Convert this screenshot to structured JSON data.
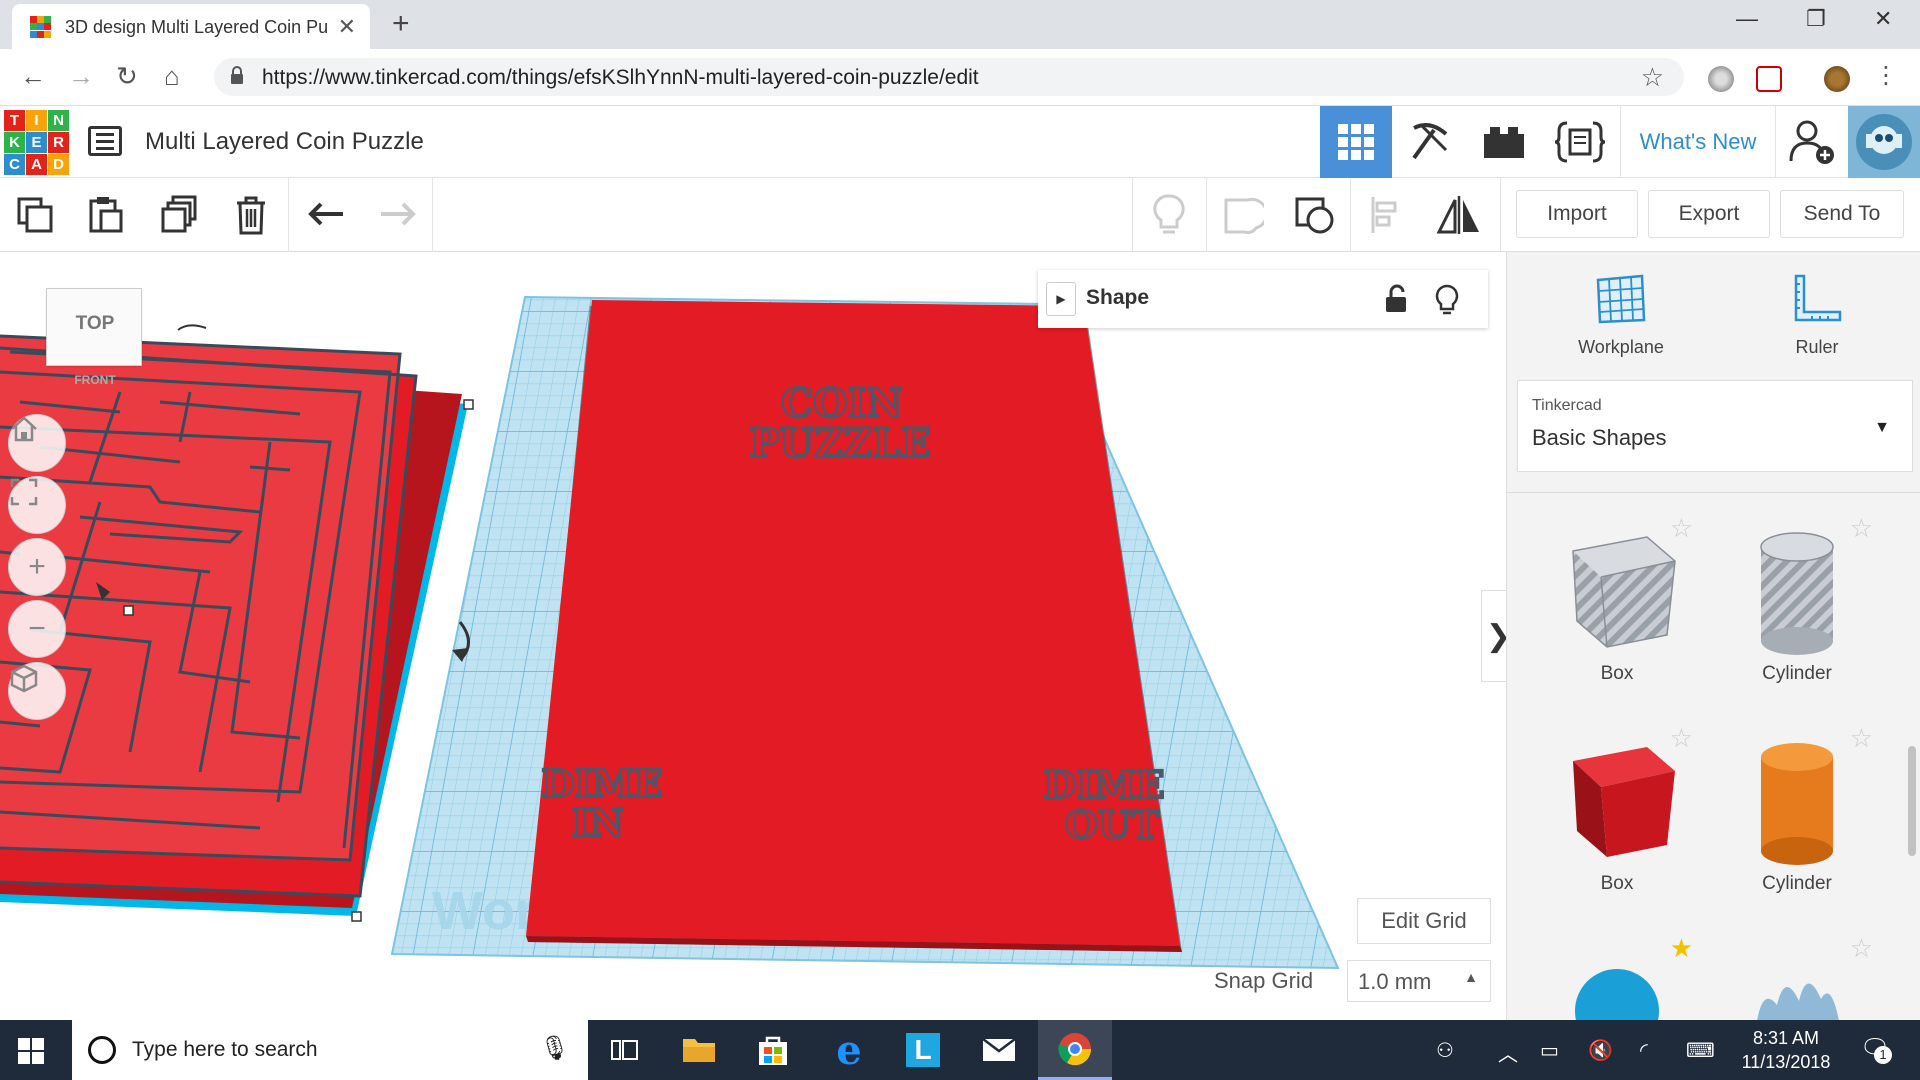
{
  "browser": {
    "tab_title": "3D design Multi Layered Coin Pu",
    "url": "https://www.tinkercad.com/things/efsKSlhYnnN-multi-layered-coin-puzzle/edit",
    "new_tab_symbol": "+",
    "close_symbol": "✕",
    "window_minimize": "—",
    "window_restore": "❐",
    "window_close": "✕"
  },
  "tinkercad": {
    "logo_letters": [
      "T",
      "I",
      "N",
      "K",
      "E",
      "R",
      "C",
      "A",
      "D"
    ],
    "logo_colors": [
      "#e2231a",
      "#f7a30c",
      "#2db34a",
      "#2db34a",
      "#2d8ecd",
      "#e2231a",
      "#2d8ecd",
      "#e2231a",
      "#f7a30c"
    ],
    "design_title": "Multi Layered Coin Puzzle",
    "whats_new": "What's New",
    "accent": "#4a90d9"
  },
  "toolbar": {
    "import_label": "Import",
    "export_label": "Export",
    "send_to_label": "Send To"
  },
  "viewport": {
    "viewcube_top": "TOP",
    "viewcube_front": "FRONT",
    "shape_panel_title": "Shape",
    "edit_grid": "Edit Grid",
    "snap_grid_label": "Snap Grid",
    "snap_grid_value": "1.0 mm",
    "workplane_label": "Workplane",
    "plate_title_line1": "COIN",
    "plate_title_line2": "PUZZLE",
    "dime_in_line1": "DIME",
    "dime_in_line2": "IN",
    "dime_out_line1": "DIME",
    "dime_out_line2": "OUT",
    "collapse_symbol": "❯"
  },
  "sidepanel": {
    "workplane": "Workplane",
    "ruler": "Ruler",
    "library_source": "Tinkercad",
    "library_name": "Basic Shapes",
    "shapes": [
      {
        "label": "Box",
        "favorite": false
      },
      {
        "label": "Cylinder",
        "favorite": false
      },
      {
        "label": "Box",
        "favorite": false
      },
      {
        "label": "Cylinder",
        "favorite": false
      },
      {
        "label": "",
        "favorite": true
      },
      {
        "label": "",
        "favorite": false
      }
    ]
  },
  "taskbar": {
    "search_placeholder": "Type here to search",
    "time": "8:31 AM",
    "date": "11/13/2018",
    "notification_count": "1"
  }
}
